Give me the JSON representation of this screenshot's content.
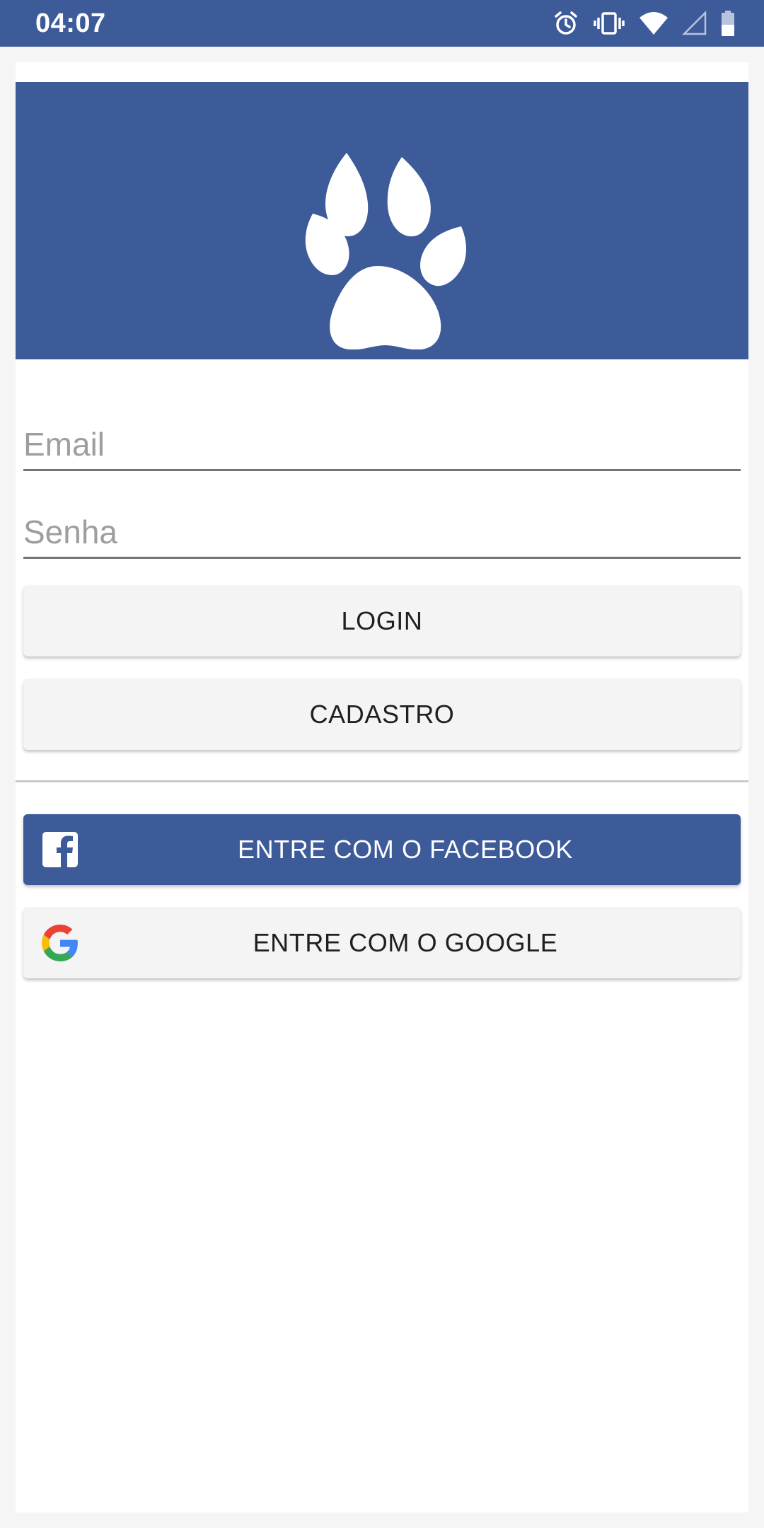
{
  "status_bar": {
    "time": "04:07",
    "icons": [
      "alarm-icon",
      "vibrate-icon",
      "wifi-icon",
      "cell-signal-icon",
      "battery-icon"
    ]
  },
  "banner": {
    "background": "#3d5a99",
    "logo_icon": "paw-icon"
  },
  "form": {
    "email_placeholder": "Email",
    "email_value": "",
    "password_placeholder": "Senha",
    "password_value": ""
  },
  "buttons": {
    "login_label": "LOGIN",
    "register_label": "CADASTRO",
    "facebook_label": "ENTRE COM O FACEBOOK",
    "google_label": "ENTRE COM O GOOGLE"
  },
  "colors": {
    "brand": "#3d5a99",
    "button_bg": "#f4f4f4",
    "text": "#1f1f1f"
  }
}
